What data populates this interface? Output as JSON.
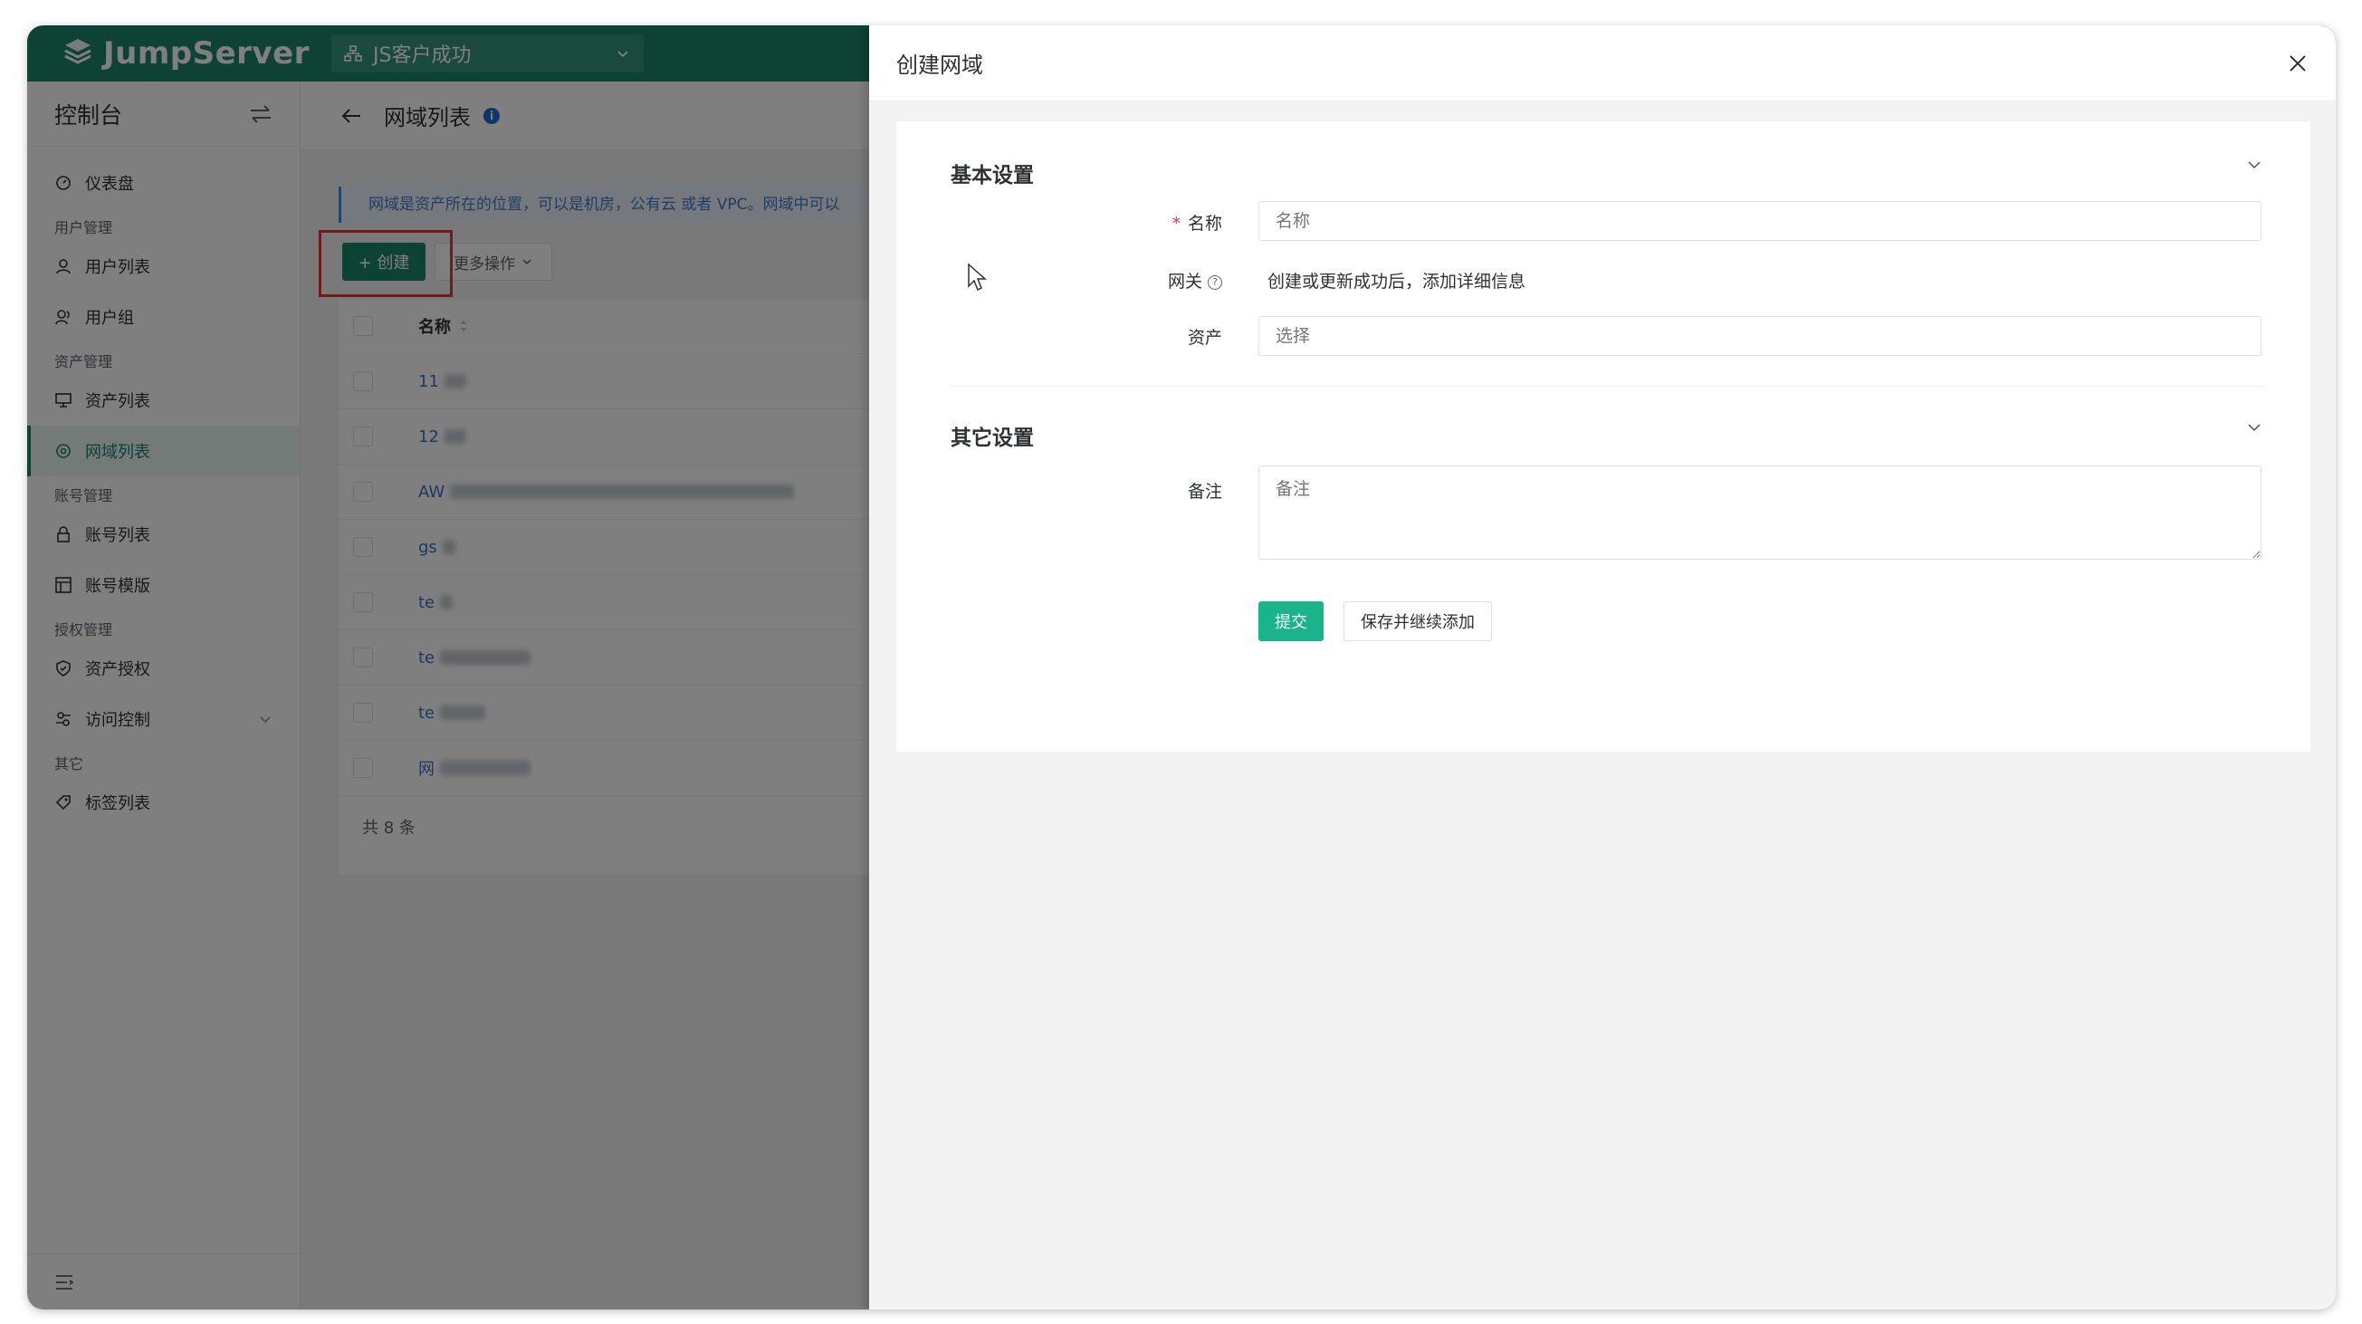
{
  "topbar": {
    "logo_text": "JumpServer",
    "org_label": "JS客户成功"
  },
  "sidebar": {
    "title": "控制台",
    "groups": {
      "dashboard": "仪表盘",
      "user_mgmt": "用户管理",
      "user_list": "用户列表",
      "user_group": "用户组",
      "asset_mgmt": "资产管理",
      "asset_list": "资产列表",
      "domain_list": "网域列表",
      "account_mgmt": "账号管理",
      "account_list": "账号列表",
      "account_template": "账号模版",
      "perm_mgmt": "授权管理",
      "asset_perm": "资产授权",
      "access_control": "访问控制",
      "other": "其它",
      "label_list": "标签列表"
    }
  },
  "main": {
    "page_title": "网域列表",
    "tip": "网域是资产所在的位置，可以是机房，公有云 或者 VPC。网域中可以",
    "create_label": "+ 创建",
    "more_label": "更多操作",
    "table": {
      "header": "名称",
      "rows": [
        "11",
        "12",
        "AW",
        "gs",
        "te",
        "te",
        "te",
        "网"
      ]
    },
    "total": "共 8 条"
  },
  "drawer": {
    "title": "创建网域",
    "basic_section": "基本设置",
    "other_section": "其它设置",
    "name_label": "名称",
    "name_placeholder": "名称",
    "gateway_label": "网关",
    "gateway_text": "创建或更新成功后，添加详细信息",
    "asset_label": "资产",
    "asset_placeholder": "选择",
    "comment_label": "备注",
    "comment_placeholder": "备注",
    "submit_label": "提交",
    "save_continue_label": "保存并继续添加"
  },
  "colors": {
    "brand": "#1a856a",
    "submit": "#1ab38c",
    "required": "#e53935",
    "highlight": "#e53935"
  }
}
